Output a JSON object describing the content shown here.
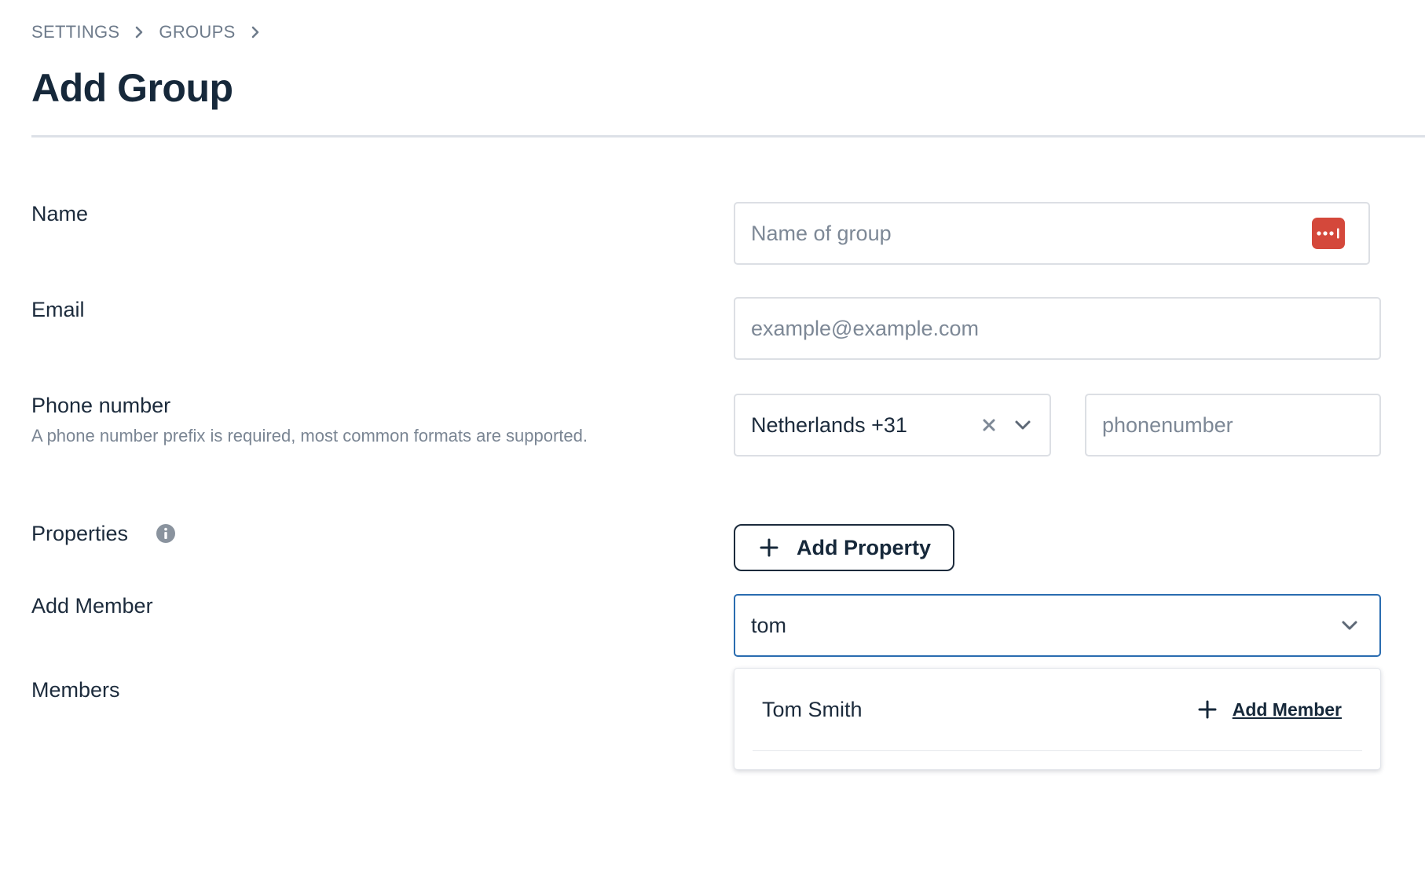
{
  "breadcrumb": {
    "items": [
      "SETTINGS",
      "GROUPS"
    ]
  },
  "page": {
    "title": "Add Group"
  },
  "form": {
    "name": {
      "label": "Name",
      "value": "",
      "placeholder": "Name of group",
      "password_manager_icon": "password-manager-icon"
    },
    "email": {
      "label": "Email",
      "value": "",
      "placeholder": "example@example.com"
    },
    "phone": {
      "label": "Phone number",
      "hint": "A phone number prefix is required, most common formats are supported.",
      "country_selected": "Netherlands +31",
      "number_value": "",
      "number_placeholder": "phonenumber"
    },
    "properties": {
      "label": "Properties",
      "info_icon": "info-icon",
      "add_button_label": "Add Property"
    },
    "add_member": {
      "label": "Add Member",
      "query": "tom",
      "results": [
        {
          "name": "Tom Smith",
          "action_label": "Add Member"
        }
      ]
    },
    "members": {
      "label": "Members"
    }
  },
  "colors": {
    "text_primary": "#1c2b3c",
    "text_muted": "#6e7b8b",
    "focus_border": "#2a6cb0",
    "password_manager_badge": "#d4483b",
    "field_border": "#dcdfe4"
  }
}
